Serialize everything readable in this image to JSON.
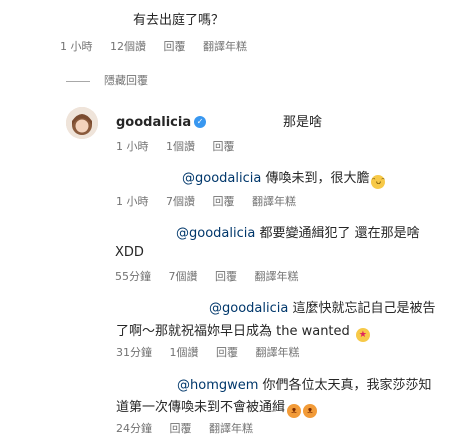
{
  "comments": [
    {
      "text": "有去出庭了嗎？",
      "meta": {
        "time": "1 小時",
        "reads": "12個讚",
        "reply": "回覆",
        "translate": "翻譯年糕"
      }
    },
    {
      "hide_replies": "隱藏回覆"
    },
    {
      "username": "goodalicia",
      "text": "那是啥",
      "meta": {
        "time": "1 小時",
        "reads": "1個讚",
        "reply": "回覆"
      }
    },
    {
      "mention": "@goodalicia",
      "text": "傳喚未到，很大膽",
      "emoji": "laughing-face-icon",
      "meta": {
        "time": "1 小時",
        "reads": "7個讚",
        "reply": "回覆",
        "translate": "翻譯年糕"
      }
    },
    {
      "mention": "@goodalicia",
      "text_line1": "都要變通緝犯了 還在那是啥",
      "text_line2": "XDD",
      "meta": {
        "time": "55分鐘",
        "reads": "7個讚",
        "reply": "回覆",
        "translate": "翻譯年糕"
      }
    },
    {
      "mention": "@goodalicia",
      "text_line1": "這麼快就忘記自己是被告",
      "text_line2": "了啊～那就祝福妳早日成為 the wanted",
      "emoji": "star-struck-face-icon",
      "meta": {
        "time": "31分鐘",
        "reads": "1個讚",
        "reply": "回覆",
        "translate": "翻譯年糕"
      }
    },
    {
      "mention": "@homgwem",
      "text_line1": "你們各位太天真，我家莎莎知",
      "text_line2": "道第一次傳喚未到不會被通緝",
      "emoji": "weary-cat-icon",
      "meta": {
        "time": "24分鐘",
        "reply": "回覆",
        "translate": "翻譯年糕"
      }
    }
  ]
}
